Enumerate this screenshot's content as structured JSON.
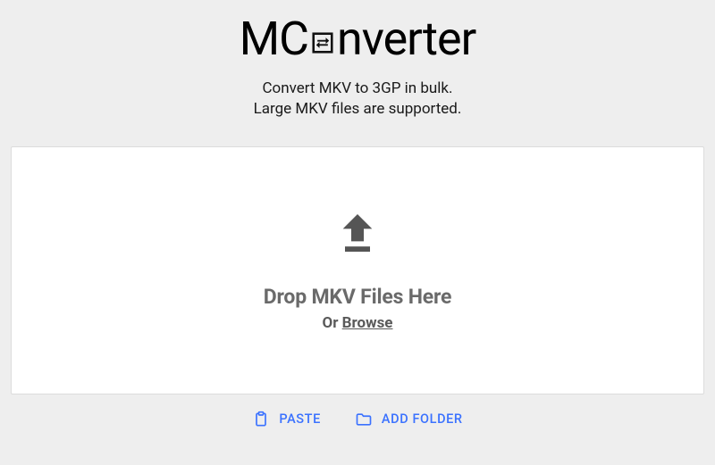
{
  "brand": {
    "name_left": "MC",
    "name_right": "nverter"
  },
  "tagline": {
    "line1": "Convert MKV to 3GP in bulk.",
    "line2": "Large MKV files are supported."
  },
  "dropzone": {
    "title": "Drop MKV Files Here",
    "or": "Or ",
    "browse": "Browse"
  },
  "actions": {
    "paste": "PASTE",
    "add_folder": "ADD FOLDER"
  },
  "colors": {
    "accent": "#3b72ff",
    "muted": "#6a6a6a"
  }
}
